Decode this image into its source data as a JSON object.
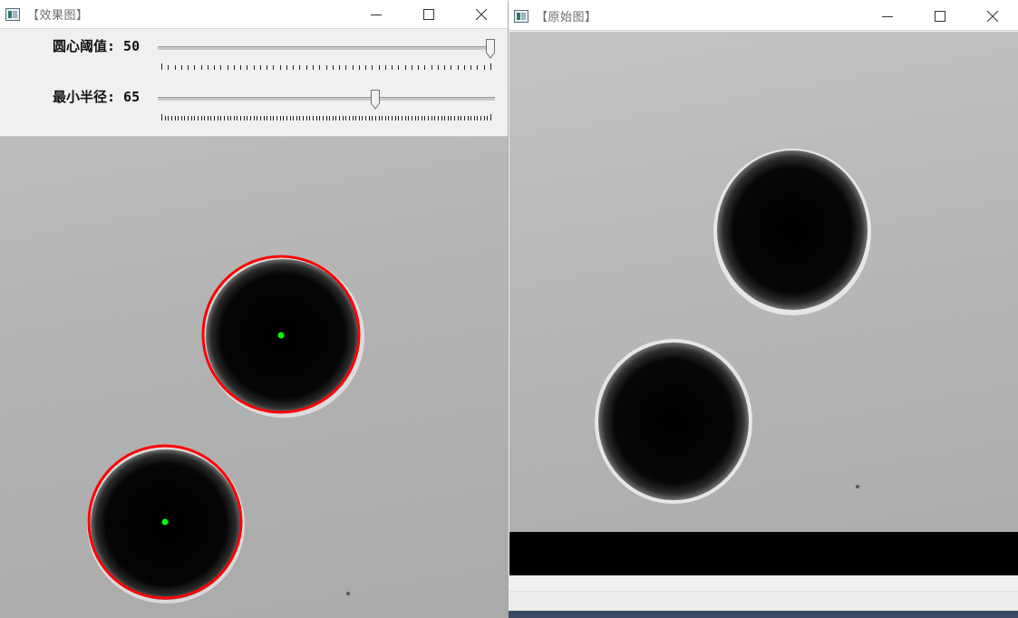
{
  "effect_window": {
    "title": "【效果图】",
    "icon": "app-window-icon",
    "trackbars": [
      {
        "label": "圆心阈值: 50",
        "value": 50,
        "max": 50,
        "ticks": 50
      },
      {
        "label": "最小半径: 65",
        "value": 65,
        "max": 100,
        "ticks": 100
      }
    ],
    "colors": {
      "circle_outline": "#ff0000",
      "center_marker": "#00ff00"
    }
  },
  "original_window": {
    "title": "【原始图】",
    "icon": "app-window-icon"
  },
  "controls": [
    "minimize-icon",
    "maximize-icon",
    "close-icon"
  ]
}
